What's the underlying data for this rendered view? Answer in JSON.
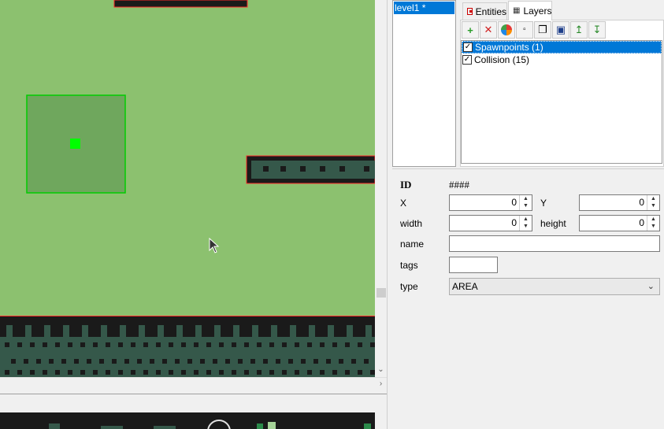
{
  "canvas": {
    "colors": {
      "background": "#8cc16f",
      "tile_dark": "#1a1a1a",
      "tile_green": "#35584a",
      "spawn_fill": "#6fa75d",
      "spawn_border": "#00cc00",
      "spawn_marker": "#00ff00",
      "selection_border": "#ff2a2a"
    }
  },
  "levels": {
    "items": [
      "level1 *"
    ]
  },
  "tabs": [
    {
      "label": "Entities",
      "icon": "entities-icon"
    },
    {
      "label": "Layers",
      "icon": "layers-icon"
    }
  ],
  "layer_toolbar": [
    "add-layer-icon",
    "delete-layer-icon",
    "color-layer-icon",
    "rename-layer-icon",
    "duplicate-layer-icon",
    "select-layer-icon",
    "move-up-icon",
    "move-down-icon"
  ],
  "layers": [
    {
      "label": "Spawnpoints (1)",
      "checked": true,
      "selected": true
    },
    {
      "label": "Collision (15)",
      "checked": true,
      "selected": false
    }
  ],
  "props": {
    "id_label": "ID",
    "id_value": "####",
    "x_label": "X",
    "x_value": "0",
    "y_label": "Y",
    "y_value": "0",
    "width_label": "width",
    "width_value": "0",
    "height_label": "height",
    "height_value": "0",
    "name_label": "name",
    "name_value": "",
    "tags_label": "tags",
    "tags_value": "",
    "type_label": "type",
    "type_value": "AREA"
  }
}
